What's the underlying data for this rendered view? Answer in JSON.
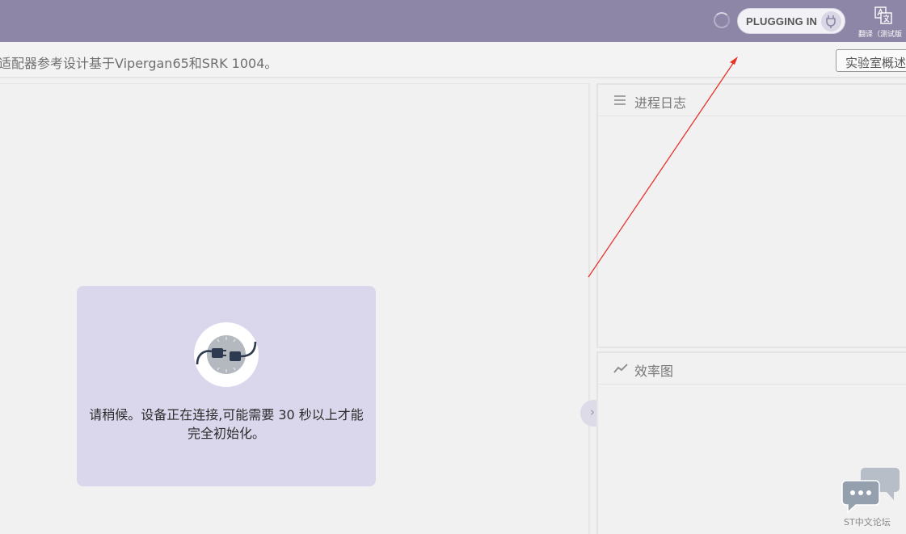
{
  "topbar": {
    "plug_status_label": "PLUGGING IN",
    "translate_label": "翻译（测试版"
  },
  "header": {
    "description": "适配器参考设计基于Vipergan65和SRK 1004。",
    "lab_overview_button": "实验室概述"
  },
  "main": {
    "connecting_message": "请稍候。设备正在连接,可能需要 30 秒以上才能完全初始化。"
  },
  "panels": {
    "process_log_title": "进程日志",
    "efficiency_chart_title": "效率图"
  },
  "watermark": {
    "text": "ST中文论坛"
  },
  "colors": {
    "topbar": "#8d86a6",
    "card": "#dad7ec",
    "annotation_arrow": "#e5332a"
  },
  "icons": {
    "spinner": "loading-spinner-icon",
    "plug": "plug-icon",
    "translate": "translate-icon",
    "process_log": "list-icon",
    "efficiency": "trend-icon",
    "collapse": "chevron-right-icon"
  }
}
